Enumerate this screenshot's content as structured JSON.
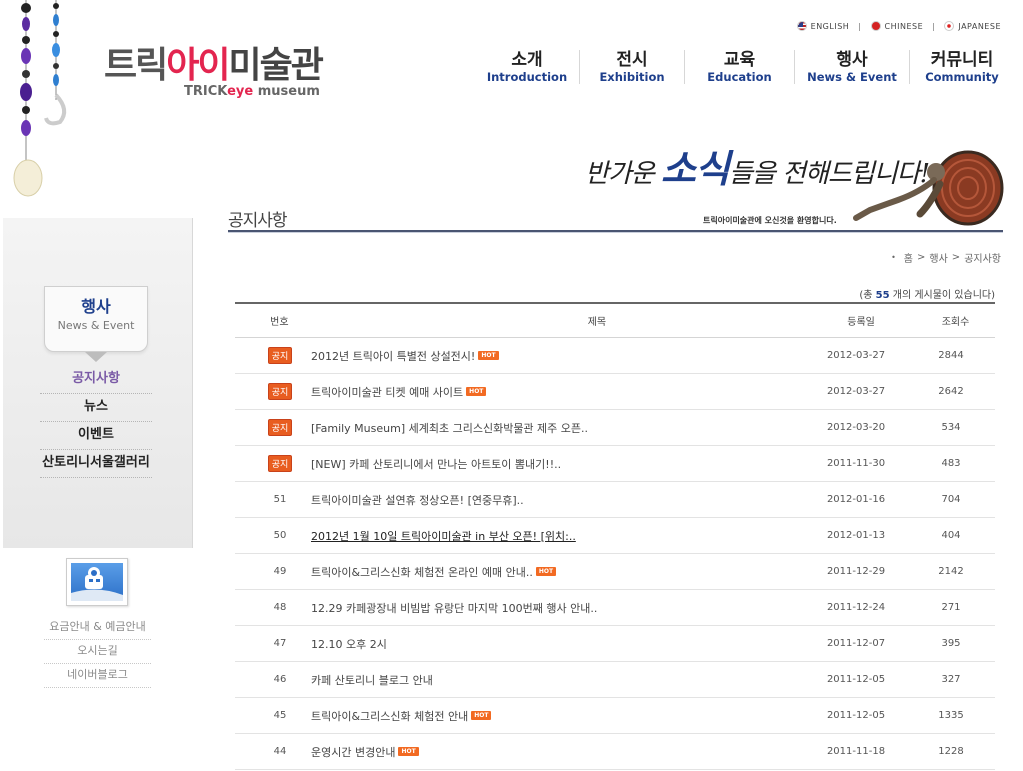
{
  "brand": {
    "logo_kr_1": "트릭",
    "logo_kr_2": "아이",
    "logo_kr_3": "미술관",
    "logo_en_1": "TRICK",
    "logo_en_2": "eye",
    "logo_en_3": " museum",
    "accent": "#e3254f",
    "nav_blue": "#1e3f8c"
  },
  "languages": [
    {
      "label": "ENGLISH",
      "icon": "us-flag-icon"
    },
    {
      "label": "CHINESE",
      "icon": "china-flag-icon"
    },
    {
      "label": "JAPANESE",
      "icon": "japan-flag-icon"
    }
  ],
  "nav": [
    {
      "kr": "소개",
      "en": "Introduction"
    },
    {
      "kr": "전시",
      "en": "Exhibition"
    },
    {
      "kr": "교육",
      "en": "Education"
    },
    {
      "kr": "행사",
      "en": "News & Event"
    },
    {
      "kr": "커뮤니티",
      "en": "Community"
    }
  ],
  "banner": {
    "text_1": "반가운 ",
    "text_big": "소식",
    "text_2": "들을 전해드립니다!",
    "sub": "트릭아이미술관에 오신것을 환영합니다."
  },
  "page": {
    "title": "공지사항",
    "breadcrumb": [
      "홈",
      "행사",
      "공지사항"
    ],
    "count_prefix": "(총 ",
    "count": "55",
    "count_suffix": " 개의 게시물이 있습니다)"
  },
  "sidebar": {
    "section_kr": "행사",
    "section_en": "News & Event",
    "menu": [
      "공지사항",
      "뉴스",
      "이벤트",
      "산토리니서울갤러리"
    ],
    "links": [
      "요금안내 & 예금안내",
      "오시는길",
      "네이버블로그"
    ]
  },
  "table": {
    "headers": {
      "no": "번호",
      "title": "제목",
      "date": "등록일",
      "views": "조회수"
    },
    "notice_label": "공지",
    "hot_label": "HOT",
    "rows": [
      {
        "no": "",
        "notice": true,
        "title": "2012년 트릭아이 특별전 상설전시!",
        "hot": true,
        "underline": false,
        "date": "2012-03-27",
        "views": "2844"
      },
      {
        "no": "",
        "notice": true,
        "title": "트릭아이미술관 티켓 예매 사이트",
        "hot": true,
        "underline": false,
        "date": "2012-03-27",
        "views": "2642"
      },
      {
        "no": "",
        "notice": true,
        "title": "[Family Museum] 세계최초 그리스신화박물관 제주 오픈..",
        "hot": false,
        "underline": false,
        "date": "2012-03-20",
        "views": "534"
      },
      {
        "no": "",
        "notice": true,
        "title": "[NEW] 카페 산토리니에서 만나는 아트토이 뽐내기!!..",
        "hot": false,
        "underline": false,
        "date": "2011-11-30",
        "views": "483"
      },
      {
        "no": "51",
        "notice": false,
        "title": "트릭아이미술관 설연휴 정상오픈! [연중무휴]..",
        "hot": false,
        "underline": false,
        "date": "2012-01-16",
        "views": "704"
      },
      {
        "no": "50",
        "notice": false,
        "title": "2012년 1월 10일 트릭아이미술관 in 부산 오픈! [위치:..",
        "hot": false,
        "underline": true,
        "date": "2012-01-13",
        "views": "404"
      },
      {
        "no": "49",
        "notice": false,
        "title": "트릭아이&그리스신화 체험전 온라인 예매 안내..",
        "hot": true,
        "underline": false,
        "date": "2011-12-29",
        "views": "2142"
      },
      {
        "no": "48",
        "notice": false,
        "title": "12.29 카페광장내 비빔밥 유랑단 마지막 100번째 행사 안내..",
        "hot": false,
        "underline": false,
        "date": "2011-12-24",
        "views": "271"
      },
      {
        "no": "47",
        "notice": false,
        "title": "12.10 오후 2시",
        "hot": false,
        "underline": false,
        "date": "2011-12-07",
        "views": "395"
      },
      {
        "no": "46",
        "notice": false,
        "title": "카페 산토리니 블로그 안내",
        "hot": false,
        "underline": false,
        "date": "2011-12-05",
        "views": "327"
      },
      {
        "no": "45",
        "notice": false,
        "title": "트릭아이&그리스신화 체험전 안내",
        "hot": true,
        "underline": false,
        "date": "2011-12-05",
        "views": "1335"
      },
      {
        "no": "44",
        "notice": false,
        "title": "운영시간 변경안내",
        "hot": true,
        "underline": false,
        "date": "2011-11-18",
        "views": "1228"
      }
    ]
  }
}
